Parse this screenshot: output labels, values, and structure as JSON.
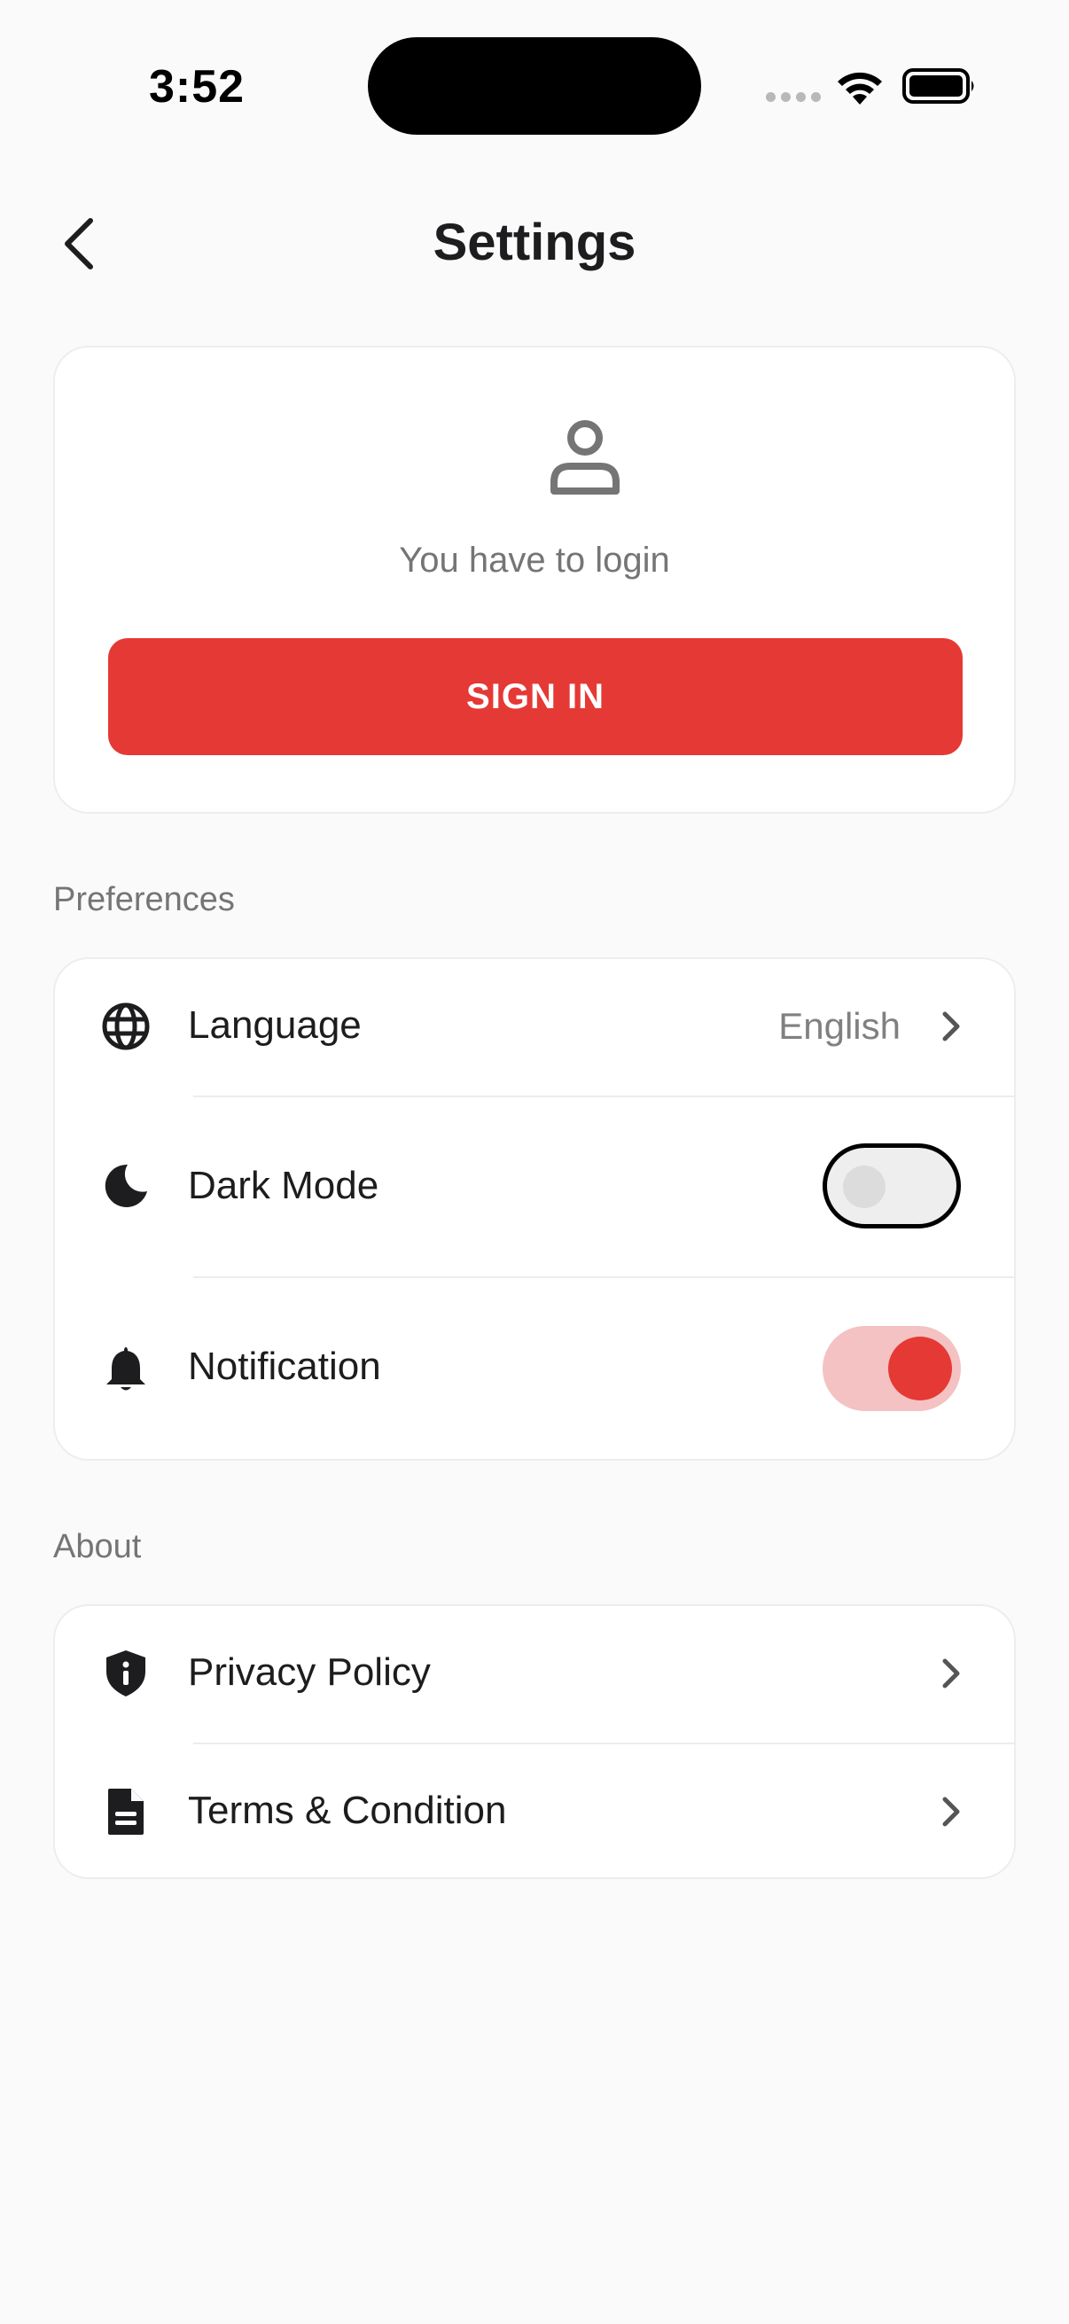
{
  "status_bar": {
    "time": "3:52"
  },
  "header": {
    "title": "Settings",
    "back_icon": "chevron-left-icon"
  },
  "login": {
    "icon": "user-icon",
    "message": "You have to login",
    "sign_in_label": "SIGN IN"
  },
  "preferences": {
    "section_label": "Preferences",
    "language": {
      "label": "Language",
      "value": "English",
      "icon": "globe-icon"
    },
    "dark_mode": {
      "label": "Dark Mode",
      "icon": "moon-icon",
      "enabled": false
    },
    "notification": {
      "label": "Notification",
      "icon": "bell-icon",
      "enabled": true
    }
  },
  "about": {
    "section_label": "About",
    "privacy": {
      "label": "Privacy Policy",
      "icon": "shield-info-icon"
    },
    "terms": {
      "label": "Terms & Condition",
      "icon": "document-icon"
    }
  },
  "colors": {
    "accent": "#e53935",
    "accent_light": "#f4c2c2",
    "background": "#fafafa",
    "card": "#ffffff",
    "muted_text": "#757575"
  }
}
